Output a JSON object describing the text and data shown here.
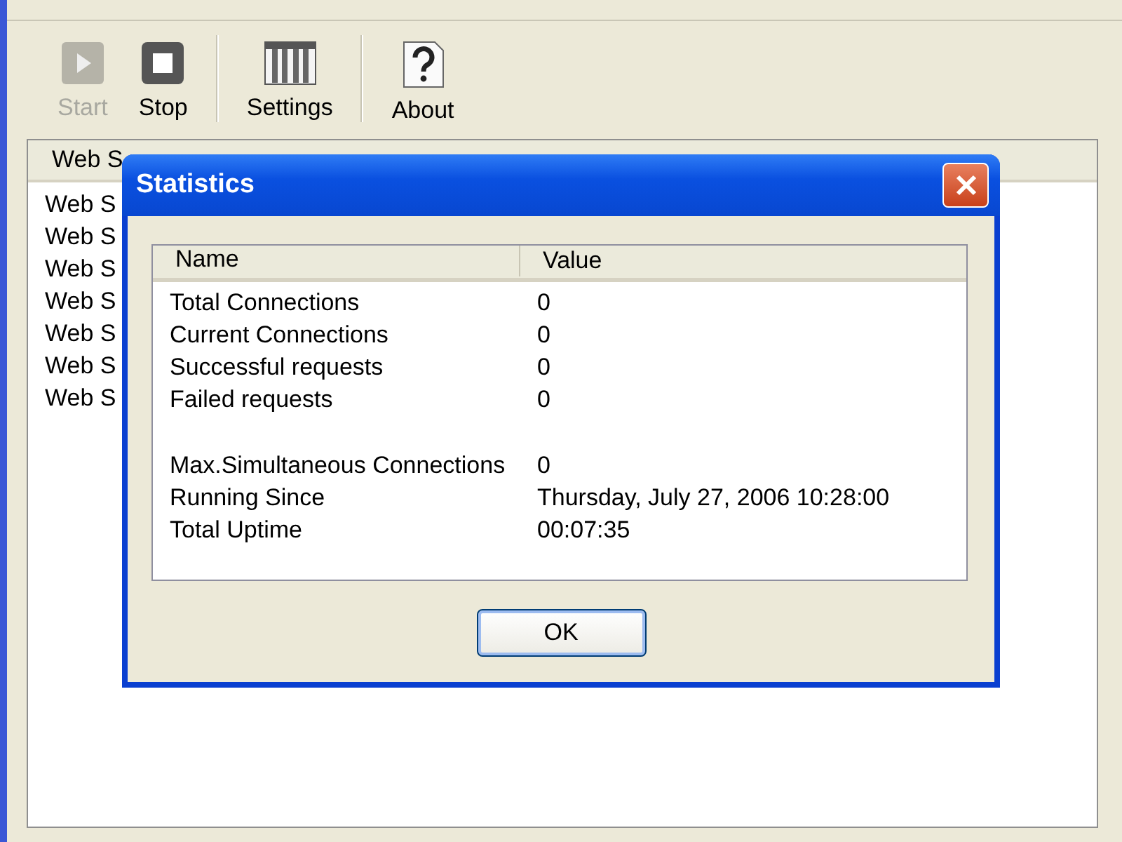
{
  "toolbar": [
    {
      "kind": "start",
      "label": "Start",
      "disabled": true
    },
    {
      "kind": "stop",
      "label": "Stop",
      "disabled": false
    },
    {
      "kind": "separator"
    },
    {
      "kind": "settings",
      "label": "Settings",
      "disabled": false
    },
    {
      "kind": "separator"
    },
    {
      "kind": "about",
      "label": "About",
      "disabled": false
    }
  ],
  "list": {
    "columns": [
      "Web S"
    ],
    "rows": [
      "Web S",
      "Web S",
      "Web S",
      "Web S",
      "Web S",
      "Web S",
      "Web S"
    ]
  },
  "dialog": {
    "title": "Statistics",
    "columns": [
      "Name",
      "Value"
    ],
    "groups": [
      [
        {
          "name": "Total Connections",
          "value": "0"
        },
        {
          "name": "Current Connections",
          "value": "0"
        },
        {
          "name": "Successful requests",
          "value": "0"
        },
        {
          "name": "Failed requests",
          "value": "0"
        }
      ],
      [
        {
          "name": "Max.Simultaneous Connections",
          "value": "0"
        },
        {
          "name": "Running Since",
          "value": "Thursday, July 27, 2006 10:28:00"
        },
        {
          "name": "Total Uptime",
          "value": "00:07:35"
        }
      ]
    ],
    "ok": "OK"
  }
}
